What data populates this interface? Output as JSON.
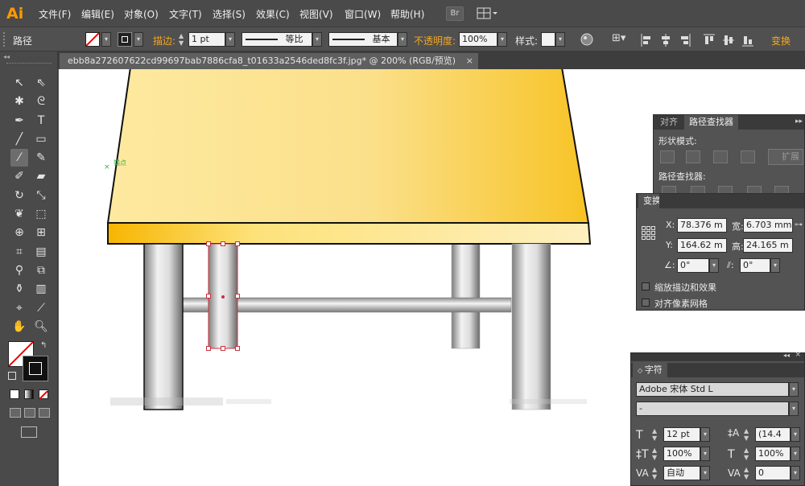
{
  "app": {
    "logo": "Ai"
  },
  "menu": {
    "items": [
      "文件(F)",
      "编辑(E)",
      "对象(O)",
      "文字(T)",
      "选择(S)",
      "效果(C)",
      "视图(V)",
      "窗口(W)",
      "帮助(H)"
    ],
    "bridge_btn": "Br"
  },
  "control": {
    "selection_type": "路径",
    "stroke_label": "描边:",
    "stroke_value": "1 pt",
    "profile_value": "等比",
    "brush_value": "基本",
    "opacity_label": "不透明度:",
    "opacity_value": "100%",
    "style_label": "样式:",
    "transform_label": "变换"
  },
  "document": {
    "tab_title": "ebb8a272607622cd99697bab7886cfa8_t01633a2546ded8fc3f.jpg* @ 200% (RGB/预览)",
    "close_glyph": "×"
  },
  "canvas": {
    "anchor_hint": "锚点"
  },
  "pathfinder": {
    "tabs": [
      "对齐",
      "路径查找器"
    ],
    "shape_modes_label": "形状模式:",
    "expand_label": "扩展",
    "pathfinders_label": "路径查找器:"
  },
  "transform": {
    "tab": "变换",
    "x_label": "X:",
    "x_value": "78.376 m",
    "y_label": "Y:",
    "y_value": "164.62 m",
    "w_label": "宽:",
    "w_value": "6.703 mm",
    "h_label": "高:",
    "h_value": "24.165 m",
    "rotate_value": "0°",
    "shear_value": "0°",
    "scale_strokes_label": "缩放描边和效果",
    "align_pixel_label": "对齐像素网格"
  },
  "character": {
    "tab": "字符",
    "font_family": "Adobe 宋体 Std L",
    "font_style": "-",
    "size_value": "12 pt",
    "leading_value": "(14.4",
    "vscale_value": "100%",
    "hscale_value": "100%",
    "kerning_value": "自动",
    "tracking_value": "0"
  },
  "colors": {
    "accent_orange": "#f5a623",
    "table_top_light": "#fde9a0",
    "table_top_dark": "#f7c325",
    "selection_red": "#c8323c"
  }
}
